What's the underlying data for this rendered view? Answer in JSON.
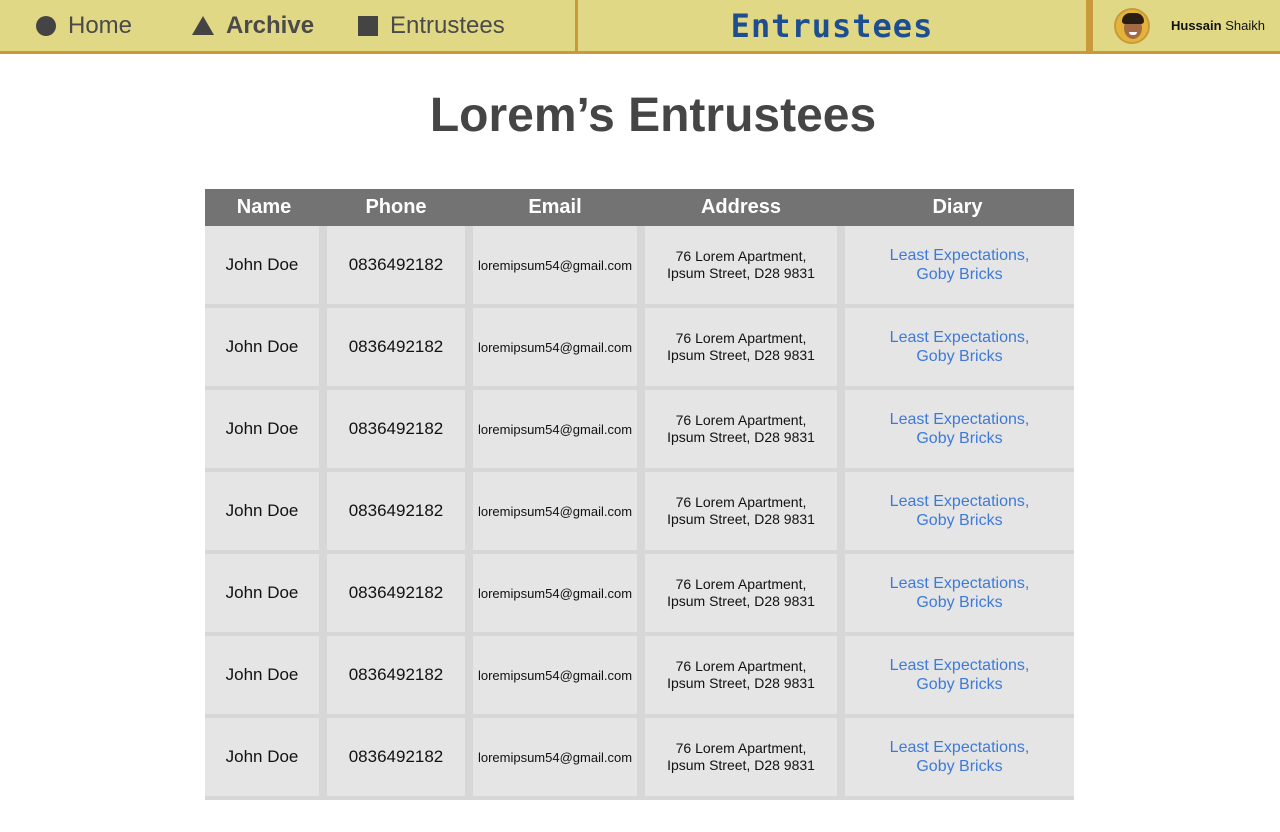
{
  "nav": {
    "items": [
      {
        "label": "Home",
        "icon": "circle-icon"
      },
      {
        "label": "Archive",
        "icon": "triangle-icon"
      },
      {
        "label": "Entrustees",
        "icon": "square-icon"
      }
    ]
  },
  "brand": "Entrustees",
  "user": {
    "first_name": "Hussain",
    "last_name": "Shaikh",
    "avatar": "avatar-photo"
  },
  "page_title": "Lorem’s Entrustees",
  "table": {
    "columns": [
      "Name",
      "Phone",
      "Email",
      "Address",
      "Diary"
    ],
    "rows": [
      {
        "name": "John Doe",
        "phone": "0836492182",
        "email": "loremipsum54@gmail.com",
        "address_line1": "76 Lorem Apartment,",
        "address_line2": "Ipsum Street, D28 9831",
        "diary_line1": "Least Expectations,",
        "diary_line2": "Goby Bricks"
      },
      {
        "name": "John Doe",
        "phone": "0836492182",
        "email": "loremipsum54@gmail.com",
        "address_line1": "76 Lorem Apartment,",
        "address_line2": "Ipsum Street, D28 9831",
        "diary_line1": "Least Expectations,",
        "diary_line2": "Goby Bricks"
      },
      {
        "name": "John Doe",
        "phone": "0836492182",
        "email": "loremipsum54@gmail.com",
        "address_line1": "76 Lorem Apartment,",
        "address_line2": "Ipsum Street, D28 9831",
        "diary_line1": "Least Expectations,",
        "diary_line2": "Goby Bricks"
      },
      {
        "name": "John Doe",
        "phone": "0836492182",
        "email": "loremipsum54@gmail.com",
        "address_line1": "76 Lorem Apartment,",
        "address_line2": "Ipsum Street, D28 9831",
        "diary_line1": "Least Expectations,",
        "diary_line2": "Goby Bricks"
      },
      {
        "name": "John Doe",
        "phone": "0836492182",
        "email": "loremipsum54@gmail.com",
        "address_line1": "76 Lorem Apartment,",
        "address_line2": "Ipsum Street, D28 9831",
        "diary_line1": "Least Expectations,",
        "diary_line2": "Goby Bricks"
      },
      {
        "name": "John Doe",
        "phone": "0836492182",
        "email": "loremipsum54@gmail.com",
        "address_line1": "76 Lorem Apartment,",
        "address_line2": "Ipsum Street, D28 9831",
        "diary_line1": "Least Expectations,",
        "diary_line2": "Goby Bricks"
      },
      {
        "name": "John Doe",
        "phone": "0836492182",
        "email": "loremipsum54@gmail.com",
        "address_line1": "76 Lorem Apartment,",
        "address_line2": "Ipsum Street, D28 9831",
        "diary_line1": "Least Expectations,",
        "diary_line2": "Goby Bricks"
      }
    ]
  },
  "colors": {
    "topbar_bg": "#e1d886",
    "topbar_border": "#c99a3c",
    "brand_text": "#1d4e8f",
    "header_bg": "#737373",
    "cell_bg": "#e5e5e5",
    "link": "#3d7ad8"
  }
}
